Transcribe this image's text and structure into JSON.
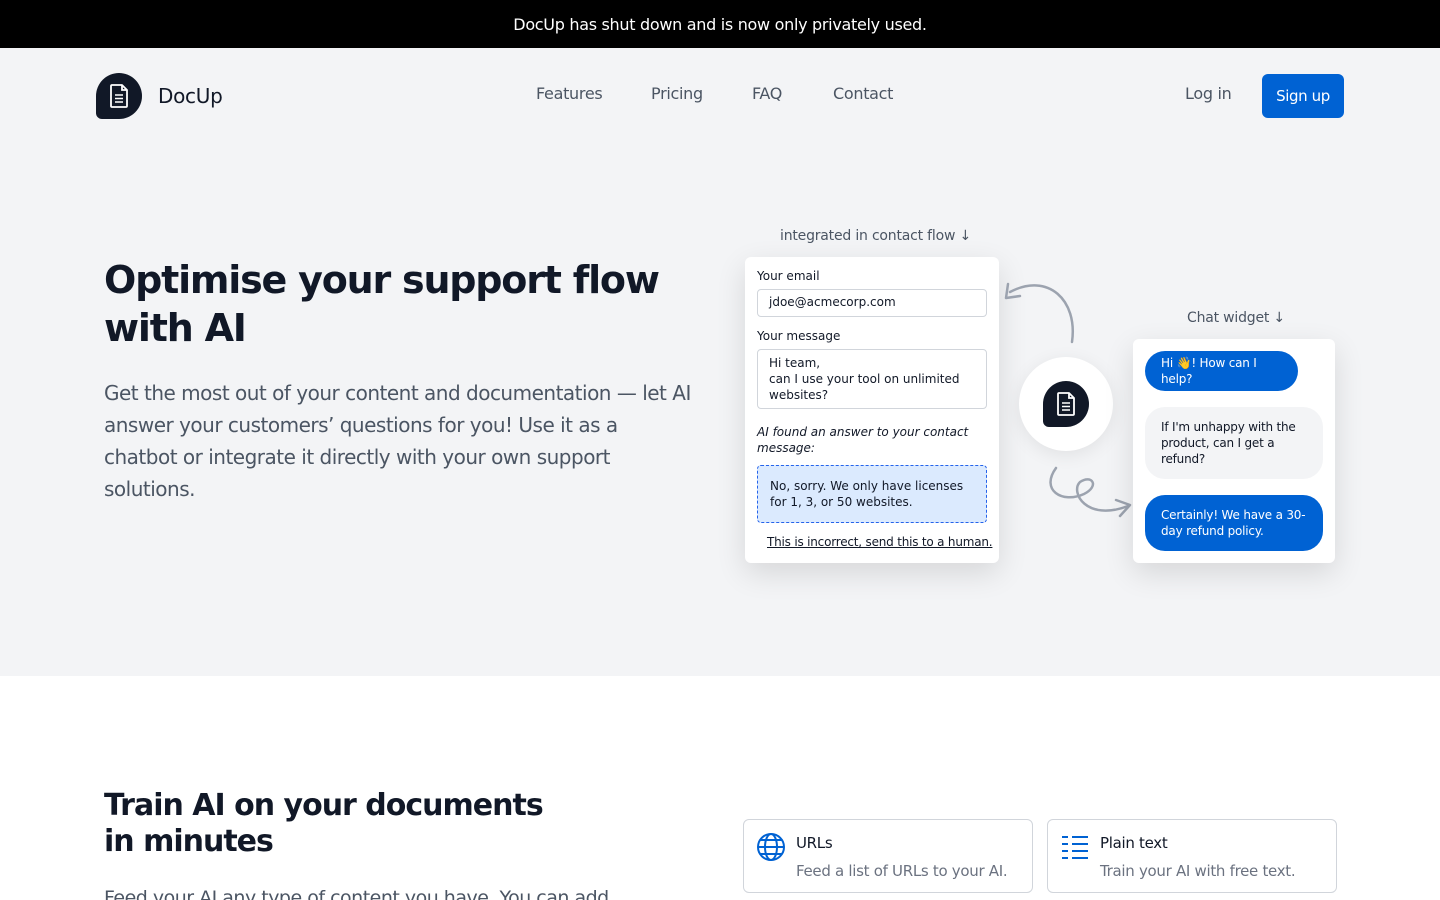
{
  "banner": {
    "text": "DocUp has shut down and is now only privately used."
  },
  "header": {
    "brand": "DocUp",
    "nav": [
      "Features",
      "Pricing",
      "FAQ",
      "Contact"
    ],
    "login": "Log in",
    "signup": "Sign up"
  },
  "hero": {
    "title": "Optimise your support flow with AI",
    "subtitle": "Get the most out of your content and documentation — let AI answer your customers’ questions for you! Use it as a chatbot or integrate it directly with your own support solutions.",
    "contact_caption": "integrated in contact flow ↓",
    "chat_caption": "Chat widget ↓",
    "form": {
      "email_label": "Your email",
      "email_value": "jdoe@acmecorp.com",
      "message_label": "Your message",
      "message_value": "Hi team,\ncan I use your tool on unlimited websites?",
      "note": "AI found an answer to your contact message:",
      "answer": "No, sorry. We only have licenses for 1, 3, or 50 websites.",
      "link": "This is incorrect, send this to a human."
    },
    "chat": {
      "greeting": "Hi 👋! How can I help?",
      "question": "If I'm unhappy with the product, can I get a refund?",
      "reply": "Certainly! We have a 30-day refund policy."
    }
  },
  "section2": {
    "title": "Train AI on your documents in minutes",
    "text": "Feed your AI any type of content you have. You can add",
    "features": [
      {
        "icon": "globe-icon",
        "title": "URLs",
        "desc": "Feed a list of URLs to your AI."
      },
      {
        "icon": "list-icon",
        "title": "Plain text",
        "desc": "Train your AI with free text."
      }
    ]
  },
  "colors": {
    "primary": "#0062d3",
    "dark": "#111827",
    "hero_bg": "#f3f4f6",
    "answer_bg": "#dbeafe"
  }
}
